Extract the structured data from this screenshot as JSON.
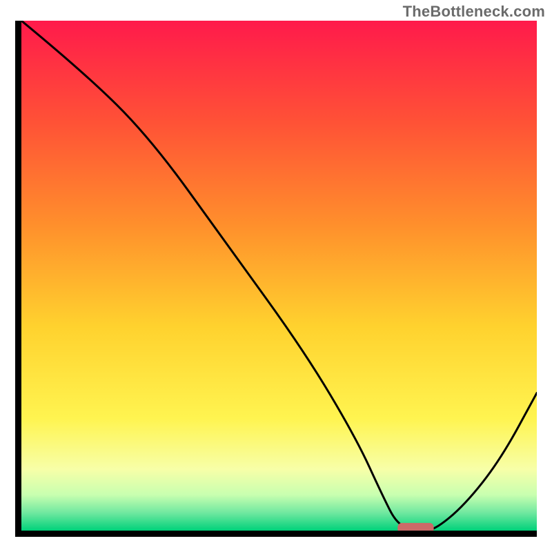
{
  "watermark": "TheBottleneck.com",
  "chart_data": {
    "type": "line",
    "title": "",
    "xlabel": "",
    "ylabel": "",
    "xlim": [
      0,
      100
    ],
    "ylim": [
      0,
      100
    ],
    "grid": false,
    "legend": false,
    "gradient_stops": [
      {
        "offset": 0.0,
        "color": "#ff1a4b"
      },
      {
        "offset": 0.2,
        "color": "#ff5236"
      },
      {
        "offset": 0.4,
        "color": "#ff8f2c"
      },
      {
        "offset": 0.6,
        "color": "#ffd22e"
      },
      {
        "offset": 0.78,
        "color": "#fff450"
      },
      {
        "offset": 0.88,
        "color": "#f7ffa8"
      },
      {
        "offset": 0.93,
        "color": "#c8ffb0"
      },
      {
        "offset": 0.965,
        "color": "#70e8a0"
      },
      {
        "offset": 1.0,
        "color": "#00d17a"
      }
    ],
    "series": [
      {
        "name": "bottleneck-curve",
        "x": [
          0,
          12,
          25,
          40,
          55,
          65,
          70,
          73,
          77,
          80,
          86,
          93,
          100
        ],
        "y": [
          100,
          90,
          77,
          56,
          35,
          18,
          7,
          1,
          0,
          0,
          5,
          14,
          27
        ]
      }
    ],
    "marker": {
      "name": "optimal-point",
      "x": 76.5,
      "y": 0.5,
      "width": 7,
      "height": 2,
      "color": "#cc6a68"
    }
  }
}
